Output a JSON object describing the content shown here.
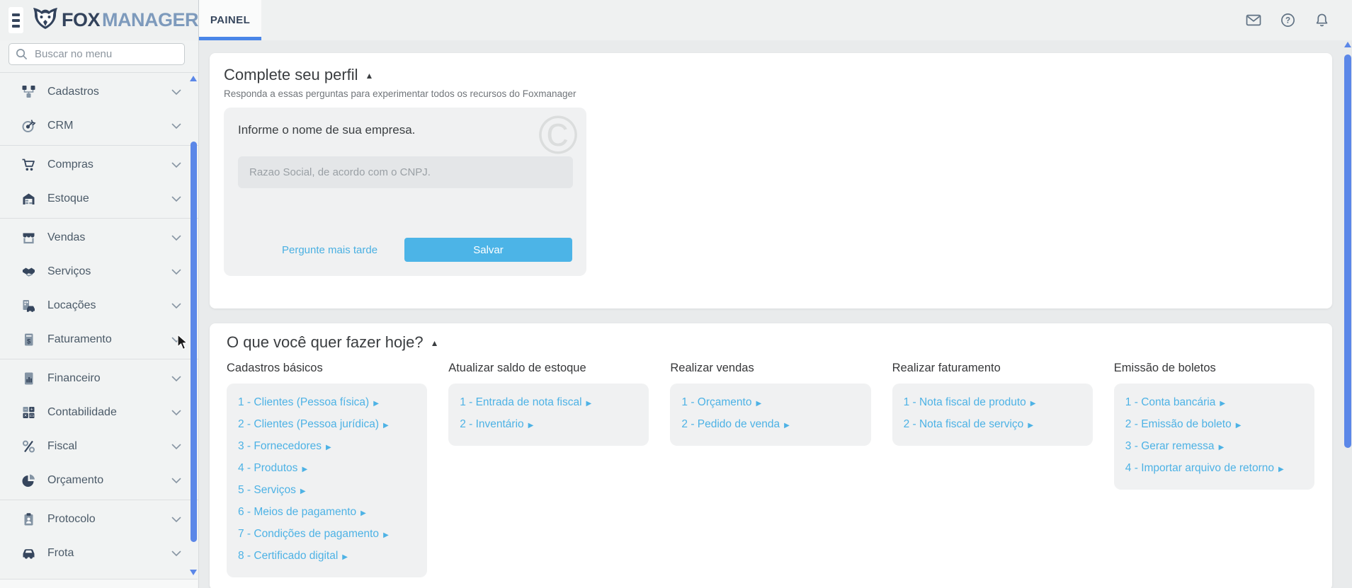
{
  "topbar": {
    "logo_fox": "FOX",
    "logo_manager": "MANAGER",
    "tab": "PAINEL",
    "icons": [
      {
        "name": "mail-icon"
      },
      {
        "name": "help-icon"
      },
      {
        "name": "bell-icon"
      }
    ]
  },
  "sidebar": {
    "search_placeholder": "Buscar no menu",
    "items": [
      {
        "label": "Cadastros",
        "icon": "sitemap-icon",
        "divider_after": false
      },
      {
        "label": "CRM",
        "icon": "target-icon",
        "divider_after": true
      },
      {
        "label": "Compras",
        "icon": "cart-icon",
        "divider_after": false
      },
      {
        "label": "Estoque",
        "icon": "warehouse-icon",
        "divider_after": true
      },
      {
        "label": "Vendas",
        "icon": "store-icon",
        "divider_after": false
      },
      {
        "label": "Serviços",
        "icon": "handshake-icon",
        "divider_after": false
      },
      {
        "label": "Locações",
        "icon": "rental-icon",
        "divider_after": false
      },
      {
        "label": "Faturamento",
        "icon": "invoice-icon",
        "divider_after": true
      },
      {
        "label": "Financeiro",
        "icon": "finance-chart-icon",
        "divider_after": false
      },
      {
        "label": "Contabilidade",
        "icon": "calculator-icon",
        "divider_after": false
      },
      {
        "label": "Fiscal",
        "icon": "percent-icon",
        "divider_after": false
      },
      {
        "label": "Orçamento",
        "icon": "pie-chart-icon",
        "divider_after": true
      },
      {
        "label": "Protocolo",
        "icon": "clipboard-icon",
        "divider_after": false
      },
      {
        "label": "Frota",
        "icon": "car-icon",
        "divider_after": false
      }
    ]
  },
  "profile_card": {
    "title": "Complete seu perfil",
    "subtitle": "Responda a essas perguntas para experimentar todos os recursos do Foxmanager",
    "question": "Informe o nome de sua empresa.",
    "input_placeholder": "Razao Social, de acordo com o CNPJ.",
    "later_label": "Pergunte mais tarde",
    "save_label": "Salvar"
  },
  "today_card": {
    "title": "O que você quer fazer hoje?",
    "columns": [
      {
        "header": "Cadastros básicos",
        "items": [
          "1 - Clientes (Pessoa física)",
          "2 - Clientes (Pessoa jurídica)",
          "3 - Fornecedores",
          "4 - Produtos",
          "5 - Serviços",
          "6 - Meios de pagamento",
          "7 - Condições de pagamento",
          "8 - Certificado digital"
        ]
      },
      {
        "header": "Atualizar saldo de estoque",
        "items": [
          "1 - Entrada de nota fiscal",
          "2 - Inventário"
        ]
      },
      {
        "header": "Realizar vendas",
        "items": [
          "1 - Orçamento",
          "2 - Pedido de venda"
        ]
      },
      {
        "header": "Realizar faturamento",
        "items": [
          "1 - Nota fiscal de produto",
          "2 - Nota fiscal de serviço"
        ]
      },
      {
        "header": "Emissão de boletos",
        "items": [
          "1 - Conta bancária",
          "2 - Emissão de boleto",
          "3 - Gerar remessa",
          "4 - Importar arquivo de retorno"
        ]
      }
    ]
  },
  "icons": {
    "link_arrow": "▶",
    "collapse": "▲",
    "watermark": "©"
  },
  "colors": {
    "accent_blue": "#4a86e8",
    "link_blue": "#4db2e5",
    "button_blue": "#4cb4e7",
    "scrollbar_blue": "#5b87e8",
    "navy": "#36465d",
    "steel": "#7d9abc",
    "sidebar_bg": "#f1f3f3",
    "main_bg": "#e9ebec",
    "panel_bg": "#f0f1f2"
  }
}
